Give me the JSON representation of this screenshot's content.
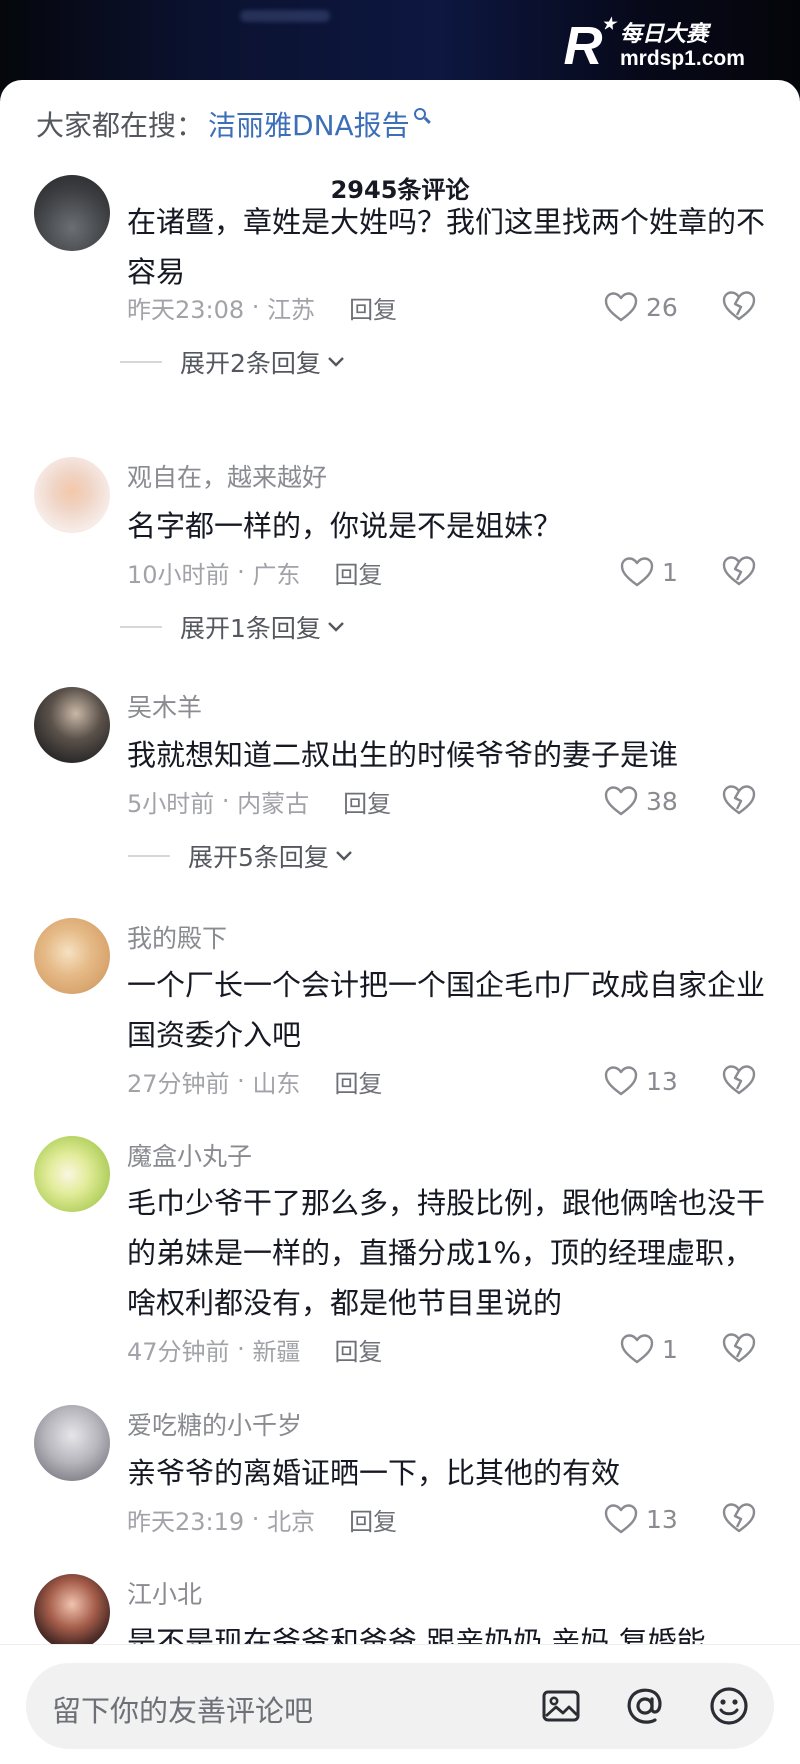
{
  "watermark": {
    "logo_letter": "R",
    "name": "每日大赛",
    "url": "mrdsp1.com"
  },
  "search": {
    "prefix": "大家都在搜：",
    "term": "洁丽雅DNA报告"
  },
  "comment_count": "2945条评论",
  "reply_label": "回复",
  "comments": [
    {
      "username": "",
      "content": "在诸暨，章姓是大姓吗？我们这里找两个姓章的不容易",
      "time": "昨天23:08",
      "location": "江苏",
      "likes": "26",
      "expand": "展开2条回复"
    },
    {
      "username": "观自在，越来越好",
      "content": "名字都一样的，你说是不是姐妹？",
      "time": "10小时前",
      "location": "广东",
      "likes": "1",
      "expand": "展开1条回复"
    },
    {
      "username": "吴木羊",
      "content": "我就想知道二叔出生的时候爷爷的妻子是谁",
      "time": "5小时前",
      "location": "内蒙古",
      "likes": "38",
      "expand": "展开5条回复"
    },
    {
      "username": "我的殿下",
      "content": "一个厂长一个会计把一个国企毛巾厂改成自家企业 国资委介入吧",
      "time": "27分钟前",
      "location": "山东",
      "likes": "13"
    },
    {
      "username": "魔盒小丸子",
      "content": "毛巾少爷干了那么多，持股比例，跟他俩啥也没干的弟妹是一样的，直播分成1%，顶的经理虚职，啥权利都没有，都是他节目里说的",
      "time": "47分钟前",
      "location": "新疆",
      "likes": "1"
    },
    {
      "username": "爱吃糖的小千岁",
      "content": "亲爷爷的离婚证晒一下，比其他的有效",
      "time": "昨天23:19",
      "location": "北京",
      "likes": "13"
    },
    {
      "username": "江小北",
      "content": "是不是现在爷爷和爸爸 跟亲奶奶 亲妈 复婚能"
    }
  ],
  "input": {
    "placeholder": "留下你的友善评论吧"
  },
  "colors": {
    "link": "#3c6fb8",
    "text": "#161823",
    "meta": "#a2a3a8",
    "sheet": "#ffffff"
  }
}
